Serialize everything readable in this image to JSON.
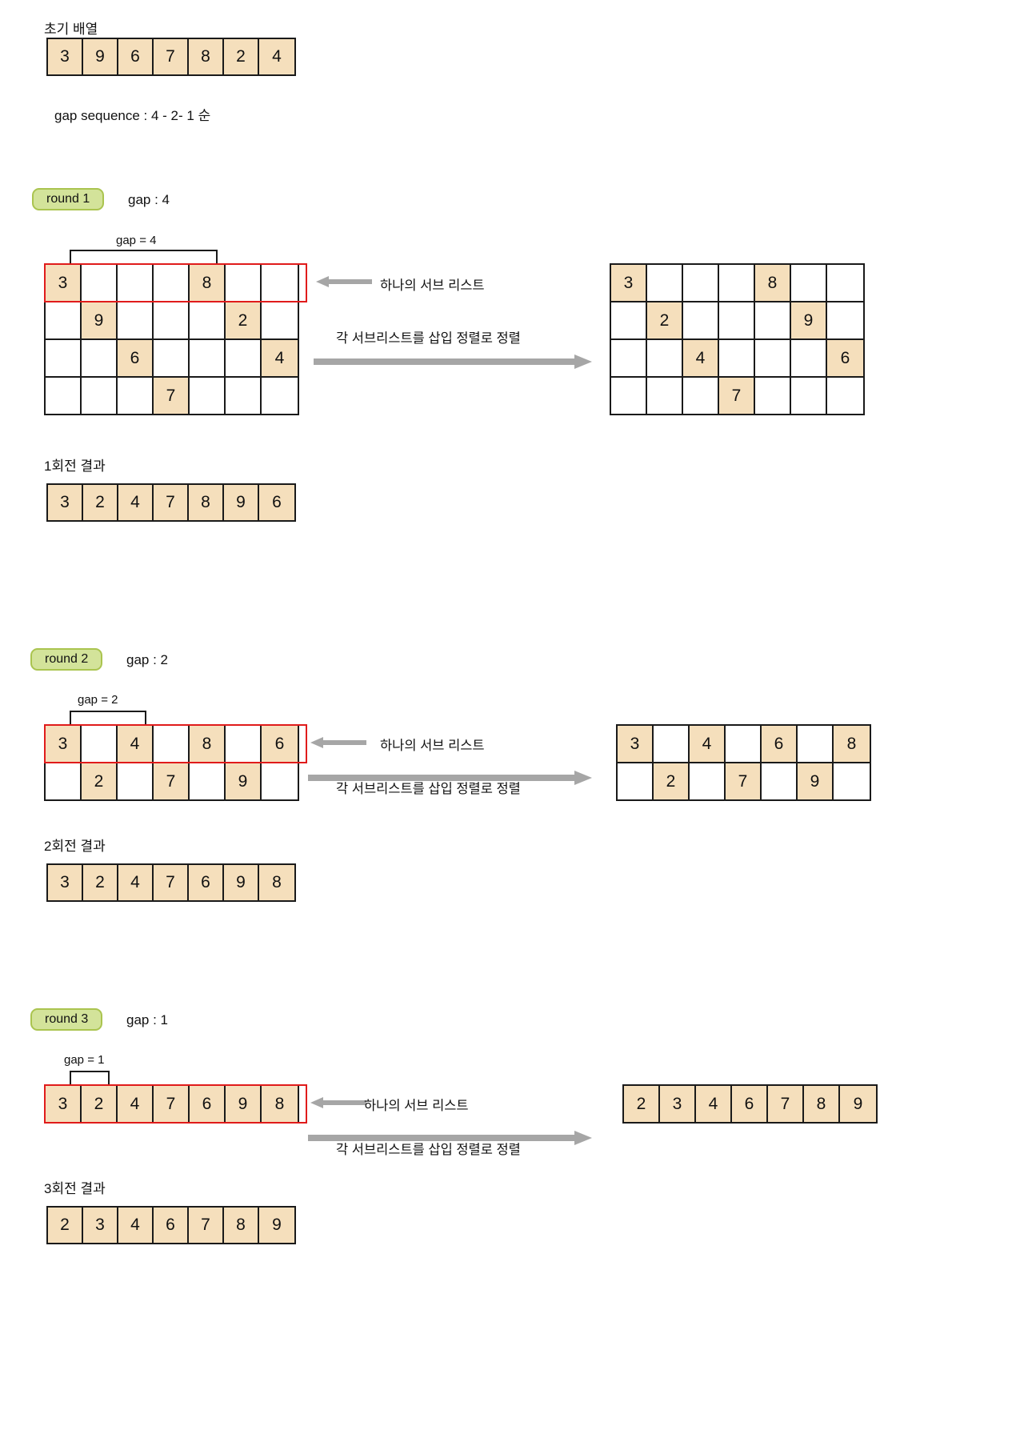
{
  "title_initial_array": "초기 배열",
  "initial_array": [
    3,
    9,
    6,
    7,
    8,
    2,
    4
  ],
  "gap_sequence_text": "gap sequence : 4 - 2- 1 순",
  "labels": {
    "sub_list_note": "하나의 서브 리스트",
    "insertion_sort_note": "각 서브리스트를 삽입 정렬로 정렬"
  },
  "colors": {
    "cell_fill": "#f5dfbc",
    "badge_fill": "#d3e39a",
    "badge_border": "#aac44f",
    "highlight_outline": "#e01b1b",
    "arrow_gray": "#a6a6a6",
    "grid_line": "#1a1a1a"
  },
  "rounds": [
    {
      "badge": "round 1",
      "gap_label": "gap : 4",
      "bracket_label": "gap = 4",
      "left_matrix": {
        "rows": 4,
        "cols": 7,
        "cells": [
          [
            3,
            "",
            "",
            "",
            8,
            "",
            ""
          ],
          [
            "",
            9,
            "",
            "",
            "",
            2,
            ""
          ],
          [
            "",
            "",
            6,
            "",
            "",
            "",
            4
          ],
          [
            "",
            "",
            "",
            7,
            "",
            "",
            ""
          ]
        ]
      },
      "right_matrix": {
        "rows": 4,
        "cols": 7,
        "cells": [
          [
            3,
            "",
            "",
            "",
            8,
            "",
            ""
          ],
          [
            "",
            2,
            "",
            "",
            "",
            9,
            ""
          ],
          [
            "",
            "",
            4,
            "",
            "",
            "",
            6
          ],
          [
            "",
            "",
            "",
            7,
            "",
            "",
            ""
          ]
        ]
      },
      "result_label": "1회전 결과",
      "result_array": [
        3,
        2,
        4,
        7,
        8,
        9,
        6
      ]
    },
    {
      "badge": "round 2",
      "gap_label": "gap : 2",
      "bracket_label": "gap = 2",
      "left_matrix": {
        "rows": 2,
        "cols": 7,
        "cells": [
          [
            3,
            "",
            4,
            "",
            8,
            "",
            6
          ],
          [
            "",
            2,
            "",
            7,
            "",
            9,
            ""
          ]
        ]
      },
      "right_matrix": {
        "rows": 2,
        "cols": 7,
        "cells": [
          [
            3,
            "",
            4,
            "",
            6,
            "",
            8
          ],
          [
            "",
            2,
            "",
            7,
            "",
            9,
            ""
          ]
        ]
      },
      "result_label": "2회전 결과",
      "result_array": [
        3,
        2,
        4,
        7,
        6,
        9,
        8
      ]
    },
    {
      "badge": "round 3",
      "gap_label": "gap : 1",
      "bracket_label": "gap = 1",
      "left_matrix": {
        "rows": 1,
        "cols": 7,
        "cells": [
          [
            3,
            2,
            4,
            7,
            6,
            9,
            8
          ]
        ]
      },
      "right_matrix": {
        "rows": 1,
        "cols": 7,
        "cells": [
          [
            2,
            3,
            4,
            6,
            7,
            8,
            9
          ]
        ]
      },
      "result_label": "3회전 결과",
      "result_array": [
        2,
        3,
        4,
        6,
        7,
        8,
        9
      ]
    }
  ]
}
